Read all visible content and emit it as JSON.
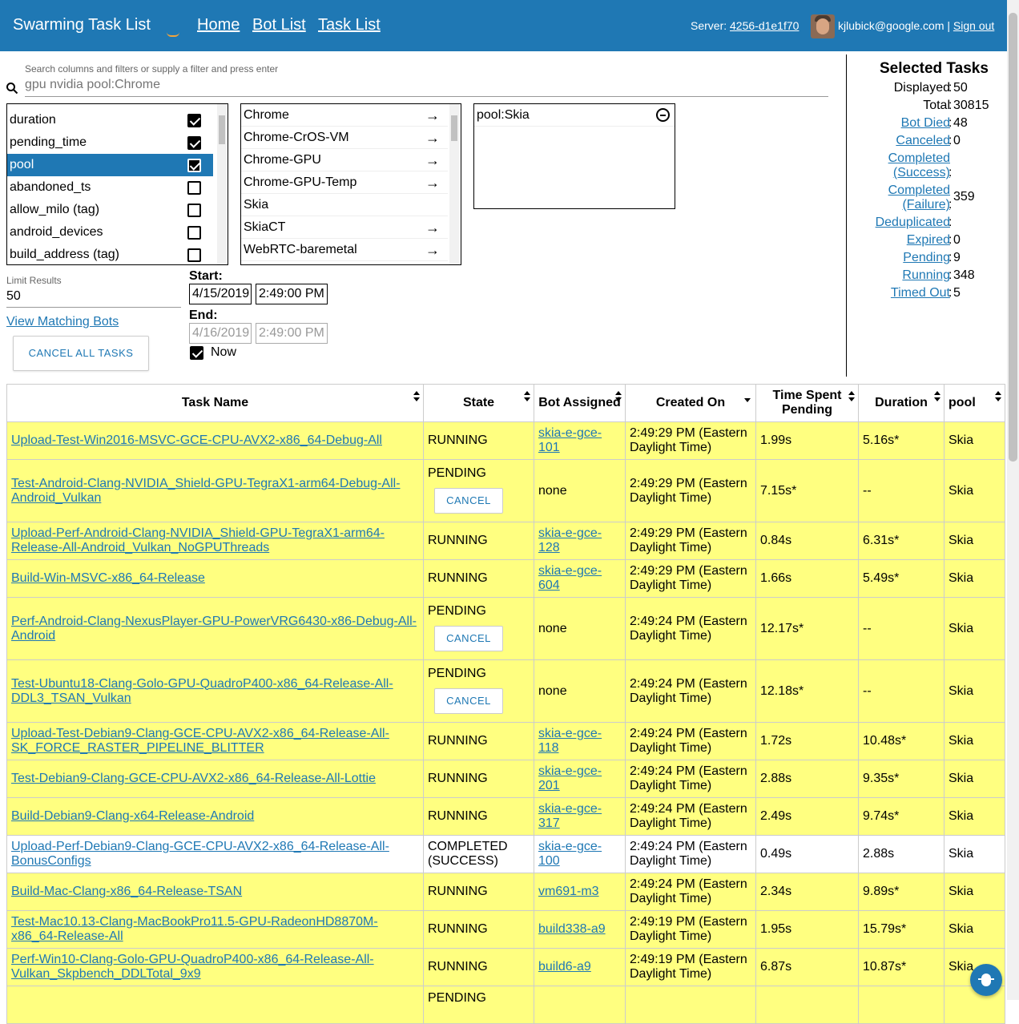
{
  "header": {
    "title": "Swarming Task List",
    "nav": [
      "Home",
      "Bot List",
      "Task List"
    ],
    "server_label": "Server:",
    "server_link": "4256-d1e1f70",
    "user": "kjlubick@google.com |",
    "signout": "Sign out"
  },
  "search": {
    "hint": "Search columns and filters or supply a filter and press enter",
    "value": "gpu nvidia pool:Chrome"
  },
  "columns_list": [
    {
      "label": "duration",
      "checked": true
    },
    {
      "label": "pending_time",
      "checked": true
    },
    {
      "label": "pool",
      "checked": true
    },
    {
      "label": "abandoned_ts",
      "checked": false
    },
    {
      "label": "allow_milo (tag)",
      "checked": false
    },
    {
      "label": "android_devices",
      "checked": false
    },
    {
      "label": "build_address (tag)",
      "checked": false
    }
  ],
  "values_list": [
    {
      "label": "Chrome",
      "arrow": true
    },
    {
      "label": "Chrome-CrOS-VM",
      "arrow": true
    },
    {
      "label": "Chrome-GPU",
      "arrow": true
    },
    {
      "label": "Chrome-GPU-Temp",
      "arrow": true
    },
    {
      "label": "Skia",
      "arrow": false
    },
    {
      "label": "SkiaCT",
      "arrow": true
    },
    {
      "label": "WebRTC-baremetal",
      "arrow": true
    }
  ],
  "filters": [
    "pool:Skia"
  ],
  "limit": {
    "label": "Limit Results",
    "value": "50"
  },
  "view_bots": "View Matching Bots",
  "cancel_all": "CANCEL ALL TASKS",
  "dates": {
    "start_label": "Start:",
    "start_date": "4/15/2019",
    "start_time": "2:49:00 PM",
    "end_label": "End:",
    "end_date": "4/16/2019",
    "end_time": "2:49:00 PM",
    "now_label": "Now"
  },
  "summary": {
    "title": "Selected Tasks",
    "rows": [
      {
        "label": "Displayed",
        "value": "50",
        "link": false
      },
      {
        "label": "Total",
        "value": "30815",
        "link": false
      },
      {
        "label": "Bot Died",
        "value": "48",
        "link": true
      },
      {
        "label": "Canceled",
        "value": "0",
        "link": true
      },
      {
        "label": "Completed (Success)",
        "value": "",
        "link": true
      },
      {
        "label": "Completed (Failure)",
        "value": "359",
        "link": true
      },
      {
        "label": "Deduplicated",
        "value": "",
        "link": true
      },
      {
        "label": "Expired",
        "value": "0",
        "link": true
      },
      {
        "label": "Pending",
        "value": "9",
        "link": true
      },
      {
        "label": "Running",
        "value": "348",
        "link": true
      },
      {
        "label": "Timed Out",
        "value": "5",
        "link": true
      }
    ]
  },
  "table": {
    "headers": [
      "Task Name",
      "State",
      "Bot Assigned",
      "Created On",
      "Time Spent Pending",
      "Duration",
      "pool"
    ],
    "cancel_label": "CANCEL",
    "rows": [
      {
        "name": "Upload-Test-Win2016-MSVC-GCE-CPU-AVX2-x86_64-Debug-All",
        "state": "RUNNING",
        "bot": "skia-e-gce-101",
        "created": "2:49:29 PM (Eastern Daylight Time)",
        "pending": "1.99s",
        "duration": "5.16s*",
        "pool": "Skia"
      },
      {
        "name": "Test-Android-Clang-NVIDIA_Shield-GPU-TegraX1-arm64-Debug-All-Android_Vulkan",
        "state": "PENDING",
        "bot": "none",
        "created": "2:49:29 PM (Eastern Daylight Time)",
        "pending": "7.15s*",
        "duration": "--",
        "pool": "Skia"
      },
      {
        "name": "Upload-Perf-Android-Clang-NVIDIA_Shield-GPU-TegraX1-arm64-Release-All-Android_Vulkan_NoGPUThreads",
        "state": "RUNNING",
        "bot": "skia-e-gce-128",
        "created": "2:49:29 PM (Eastern Daylight Time)",
        "pending": "0.84s",
        "duration": "6.31s*",
        "pool": "Skia"
      },
      {
        "name": "Build-Win-MSVC-x86_64-Release",
        "state": "RUNNING",
        "bot": "skia-e-gce-604",
        "created": "2:49:29 PM (Eastern Daylight Time)",
        "pending": "1.66s",
        "duration": "5.49s*",
        "pool": "Skia"
      },
      {
        "name": "Perf-Android-Clang-NexusPlayer-GPU-PowerVRG6430-x86-Debug-All-Android",
        "state": "PENDING",
        "bot": "none",
        "created": "2:49:24 PM (Eastern Daylight Time)",
        "pending": "12.17s*",
        "duration": "--",
        "pool": "Skia"
      },
      {
        "name": "Test-Ubuntu18-Clang-Golo-GPU-QuadroP400-x86_64-Release-All-DDL3_TSAN_Vulkan",
        "state": "PENDING",
        "bot": "none",
        "created": "2:49:24 PM (Eastern Daylight Time)",
        "pending": "12.18s*",
        "duration": "--",
        "pool": "Skia"
      },
      {
        "name": "Upload-Test-Debian9-Clang-GCE-CPU-AVX2-x86_64-Release-All-SK_FORCE_RASTER_PIPELINE_BLITTER",
        "state": "RUNNING",
        "bot": "skia-e-gce-118",
        "created": "2:49:24 PM (Eastern Daylight Time)",
        "pending": "1.72s",
        "duration": "10.48s*",
        "pool": "Skia"
      },
      {
        "name": "Test-Debian9-Clang-GCE-CPU-AVX2-x86_64-Release-All-Lottie",
        "state": "RUNNING",
        "bot": "skia-e-gce-201",
        "created": "2:49:24 PM (Eastern Daylight Time)",
        "pending": "2.88s",
        "duration": "9.35s*",
        "pool": "Skia"
      },
      {
        "name": "Build-Debian9-Clang-x64-Release-Android",
        "state": "RUNNING",
        "bot": "skia-e-gce-317",
        "created": "2:49:24 PM (Eastern Daylight Time)",
        "pending": "2.49s",
        "duration": "9.74s*",
        "pool": "Skia"
      },
      {
        "name": "Upload-Perf-Debian9-Clang-GCE-CPU-AVX2-x86_64-Release-All-BonusConfigs",
        "state": "COMPLETED (SUCCESS)",
        "bot": "skia-e-gce-100",
        "created": "2:49:24 PM (Eastern Daylight Time)",
        "pending": "0.49s",
        "duration": "2.88s",
        "pool": "Skia"
      },
      {
        "name": "Build-Mac-Clang-x86_64-Release-TSAN",
        "state": "RUNNING",
        "bot": "vm691-m3",
        "created": "2:49:24 PM (Eastern Daylight Time)",
        "pending": "2.34s",
        "duration": "9.89s*",
        "pool": "Skia"
      },
      {
        "name": "Test-Mac10.13-Clang-MacBookPro11.5-GPU-RadeonHD8870M-x86_64-Release-All",
        "state": "RUNNING",
        "bot": "build338-a9",
        "created": "2:49:19 PM (Eastern Daylight Time)",
        "pending": "1.95s",
        "duration": "15.79s*",
        "pool": "Skia"
      },
      {
        "name": "Perf-Win10-Clang-Golo-GPU-QuadroP400-x86_64-Release-All-Vulkan_Skpbench_DDLTotal_9x9",
        "state": "RUNNING",
        "bot": "build6-a9",
        "created": "2:49:19 PM (Eastern Daylight Time)",
        "pending": "6.87s",
        "duration": "10.87s*",
        "pool": "Skia"
      },
      {
        "name": "",
        "state": "PENDING",
        "bot": "",
        "created": "",
        "pending": "",
        "duration": "",
        "pool": ""
      }
    ]
  }
}
